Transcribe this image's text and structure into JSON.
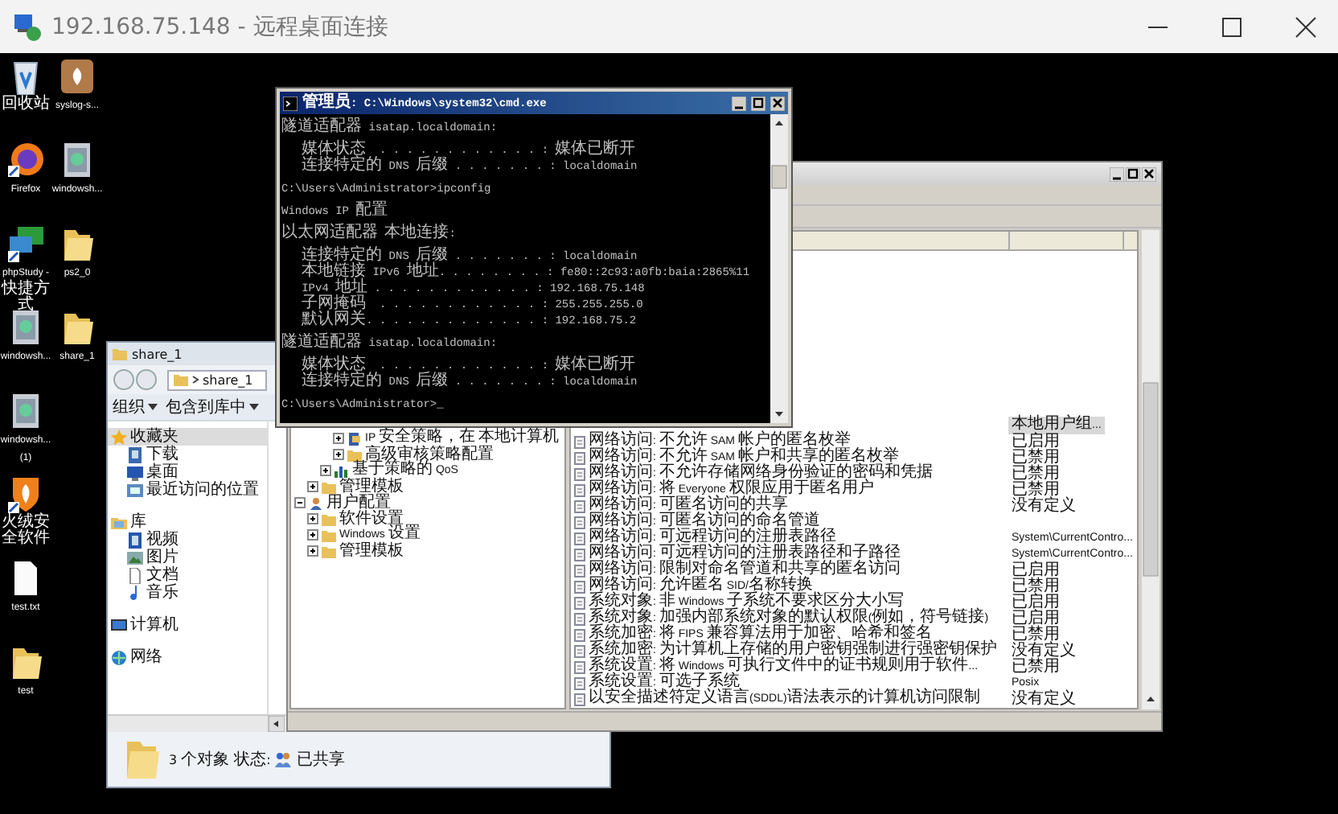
{
  "window": {
    "title": "192.168.75.148 - 远程桌面连接"
  },
  "desktop": {
    "columns": [
      [
        {
          "label": "回收站",
          "kind": "recycle"
        },
        {
          "label": "Firefox",
          "kind": "browser"
        },
        {
          "label": "phpStudy - 快捷方式",
          "kind": "server"
        },
        {
          "label": "windowsh...",
          "kind": "installer"
        },
        {
          "label": "windowsh... (1)",
          "kind": "installer"
        },
        {
          "label": "火绒安全软件",
          "kind": "shield"
        },
        {
          "label": "test.txt",
          "kind": "text"
        },
        {
          "label": "test",
          "kind": "folder"
        }
      ],
      [
        {
          "label": "syslog-s...",
          "kind": "package"
        },
        {
          "label": "windowsh...",
          "kind": "installer"
        },
        {
          "label": "ps2_0",
          "kind": "folder"
        },
        {
          "label": "share_1",
          "kind": "folder"
        }
      ]
    ]
  },
  "explorer": {
    "title": "share_1",
    "address": "share_1",
    "toolbar": [
      "组织",
      "包含到库中"
    ],
    "nav": [
      {
        "label": "收藏夹",
        "kind": "star",
        "selected": true,
        "children": [
          {
            "label": "下载",
            "kind": "download",
            "selected": false
          },
          {
            "label": "桌面",
            "kind": "desktop",
            "selected": false
          },
          {
            "label": "最近访问的位置",
            "kind": "recent",
            "selected": false
          }
        ]
      },
      {
        "label": "库",
        "kind": "library",
        "selected": false,
        "children": [
          {
            "label": "视频",
            "kind": "video",
            "selected": false
          },
          {
            "label": "图片",
            "kind": "picture",
            "selected": false
          },
          {
            "label": "文档",
            "kind": "document",
            "selected": false
          },
          {
            "label": "音乐",
            "kind": "music",
            "selected": false
          }
        ]
      },
      {
        "label": "计算机",
        "kind": "computer",
        "selected": false
      },
      {
        "label": "网络",
        "kind": "network",
        "selected": false
      }
    ],
    "status": {
      "count": "3 个对象",
      "state_label": "状态:",
      "state": "已共享"
    }
  },
  "policy_editor": {
    "tree": [
      {
        "children": [
          {
            "children": [
              {
                "children": [
                  {
                    "label": "IP 安全策略，在 本地计算机",
                    "kind": "security",
                    "expanded": false
                  },
                  {
                    "label": "高级审核策略配置",
                    "kind": "folder",
                    "expanded": false
                  }
                ]
              },
              {
                "label": "基于策略的 QoS",
                "kind": "chart",
                "expanded": false
              }
            ]
          },
          {
            "label": "管理模板",
            "kind": "folder",
            "expanded": false
          }
        ]
      },
      {
        "label": "用户配置",
        "kind": "user",
        "expanded": true,
        "children": [
          {
            "label": "软件设置",
            "kind": "folder",
            "expanded": false
          },
          {
            "label": "Windows 设置",
            "kind": "folder",
            "expanded": false
          },
          {
            "label": "管理模板",
            "kind": "folder",
            "expanded": false
          }
        ]
      }
    ],
    "rows": [
      {
        "value": "本地用户组...",
        "selected": true
      },
      {
        "name": "网络访问: 不允许 SAM 帐户的匿名枚举",
        "value": "已启用",
        "selected": false
      },
      {
        "name": "网络访问: 不允许 SAM 帐户和共享的匿名枚举",
        "value": "已禁用",
        "selected": false
      },
      {
        "name": "网络访问: 不允许存储网络身份验证的密码和凭据",
        "value": "已禁用",
        "selected": false
      },
      {
        "name": "网络访问: 将 Everyone 权限应用于匿名用户",
        "value": "已禁用",
        "selected": false
      },
      {
        "name": "网络访问: 可匿名访问的共享",
        "value": "没有定义",
        "selected": false
      },
      {
        "name": "网络访问: 可匿名访问的命名管道",
        "selected": false
      },
      {
        "name": "网络访问: 可远程访问的注册表路径",
        "value": "System\\CurrentContro...",
        "selected": false
      },
      {
        "name": "网络访问: 可远程访问的注册表路径和子路径",
        "value": "System\\CurrentContro...",
        "selected": false
      },
      {
        "name": "网络访问: 限制对命名管道和共享的匿名访问",
        "value": "已启用",
        "selected": false
      },
      {
        "name": "网络访问: 允许匿名 SID/名称转换",
        "value": "已禁用",
        "selected": false
      },
      {
        "name": "系统对象: 非 Windows 子系统不要求区分大小写",
        "value": "已启用",
        "selected": false
      },
      {
        "name": "系统对象: 加强内部系统对象的默认权限(例如，符号链接)",
        "value": "已启用",
        "selected": false
      },
      {
        "name": "系统加密: 将 FIPS 兼容算法用于加密、哈希和签名",
        "value": "已禁用",
        "selected": false
      },
      {
        "name": "系统加密: 为计算机上存储的用户密钥强制进行强密钥保护",
        "value": "没有定义",
        "selected": false
      },
      {
        "name": "系统设置: 将 Windows 可执行文件中的证书规则用于软件...",
        "value": "已禁用",
        "selected": false
      },
      {
        "name": "系统设置: 可选子系统",
        "value": "Posix",
        "selected": false
      },
      {
        "name": "以安全描述符定义语言(SDDL)语法表示的计算机访问限制",
        "value": "没有定义",
        "selected": false
      }
    ]
  },
  "cmd": {
    "title": "管理员: C:\\Windows\\system32\\cmd.exe",
    "blocks": [
      [
        "隧道适配器 isatap.localdomain:"
      ],
      [
        "   媒体状态  . . . . . . . . . . . . : 媒体已断开",
        "   连接特定的 DNS 后缀 . . . . . . . : localdomain"
      ],
      [
        "C:\\Users\\Administrator>ipconfig"
      ],
      [
        "Windows IP 配置"
      ],
      [
        "以太网适配器 本地连接:"
      ],
      [
        "   连接特定的 DNS 后缀 . . . . . . . : localdomain",
        "   本地链接 IPv6 地址. . . . . . . . : fe80::2c93:a0fb:baia:2865%11",
        "   IPv4 地址 . . . . . . . . . . . . : 192.168.75.148",
        "   子网掩码  . . . . . . . . . . . . : 255.255.255.0",
        "   默认网关. . . . . . . . . . . . . : 192.168.75.2"
      ],
      [
        "隧道适配器 isatap.localdomain:"
      ],
      [
        "   媒体状态  . . . . . . . . . . . . : 媒体已断开",
        "   连接特定的 DNS 后缀 . . . . . . . : localdomain"
      ],
      [
        "C:\\Users\\Administrator>_"
      ]
    ]
  }
}
